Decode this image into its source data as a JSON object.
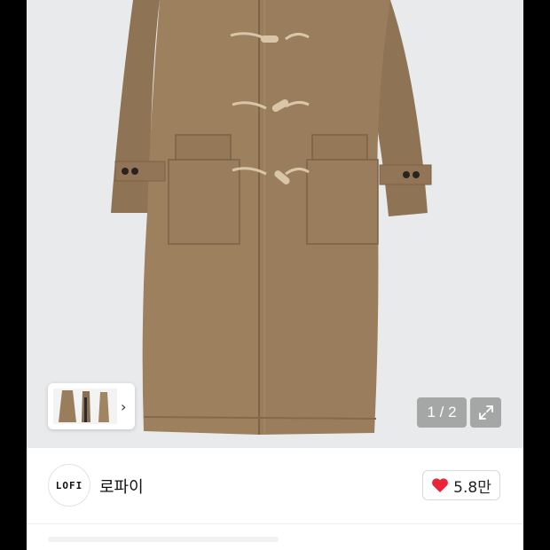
{
  "product_image": {
    "alt": "",
    "pager": "1 / 2"
  },
  "thumbnail_strip": {
    "arrow": "›"
  },
  "shop": {
    "logo_text": "LOFI",
    "name": "로파이"
  },
  "like": {
    "count": "5.8만",
    "heart_color": "#e8263a"
  },
  "colors": {
    "coat": "#9a7d5c",
    "toggle": "#d9c6a8",
    "background": "#e9eaec"
  }
}
